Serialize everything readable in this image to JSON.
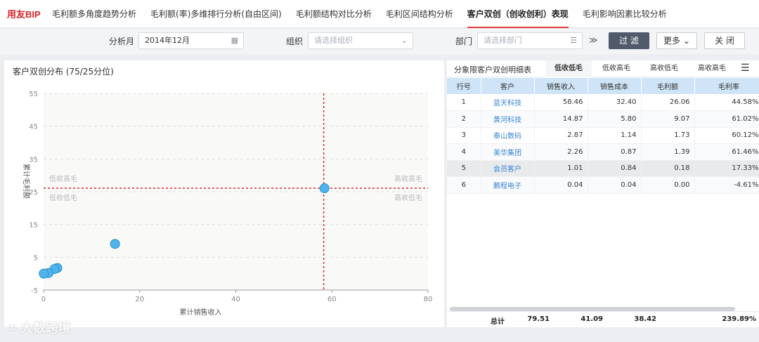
{
  "logo": "用友BIP",
  "tabs": [
    "毛利额多角度趋势分析",
    "毛利额(率)多维排行分析(自由区间)",
    "毛利额结构对比分析",
    "毛利区间结构分析",
    "客户双创（创收创利）表现",
    "毛利影响因素比较分析"
  ],
  "active_tab": 4,
  "filters": {
    "month_label": "分析月",
    "month_value": "2014年12月",
    "org_label": "组织",
    "org_placeholder": "请选择组织",
    "dept_label": "部门",
    "dept_placeholder": "请选择部门",
    "filter_btn": "过 滤",
    "more_btn": "更多",
    "close_btn": "关 闭"
  },
  "chart_data": {
    "type": "scatter",
    "title": "客户双创分布 (75/25分位)",
    "xlabel": "累计销售收入",
    "ylabel": "累计毛利额",
    "xlim": [
      0,
      80
    ],
    "ylim": [
      -5,
      55
    ],
    "xticks": [
      0,
      20,
      40,
      60,
      80
    ],
    "yticks": [
      -5,
      5,
      15,
      25,
      35,
      45,
      55
    ],
    "points": [
      [
        58.46,
        26.06
      ],
      [
        14.87,
        9.07
      ],
      [
        2.87,
        1.73
      ],
      [
        2.26,
        1.39
      ],
      [
        1.01,
        0.18
      ],
      [
        0.04,
        0
      ]
    ],
    "threshold_x": 58.3,
    "threshold_y": 26.06,
    "quadrant_labels": {
      "top_left": "低收高毛",
      "top_right": "高收高毛",
      "bottom_left": "低收低毛",
      "bottom_right": "高收低毛"
    },
    "colors": {
      "point": "#4fb4ea",
      "point_stroke": "#2a8fd0",
      "threshold": "#d9262c"
    }
  },
  "panel": {
    "title": "分象限客户双创明细表",
    "quadrant_tabs": [
      "低收低毛",
      "低收高毛",
      "高收低毛",
      "高收高毛"
    ],
    "active_quadrant": 0,
    "columns": [
      "行号",
      "客户",
      "销售收入",
      "销售成本",
      "毛利额",
      "毛利率"
    ],
    "rows": [
      [
        "1",
        "蓝天科技",
        "58.46",
        "32.40",
        "26.06",
        "44.58%"
      ],
      [
        "2",
        "黄河科技",
        "14.87",
        "5.80",
        "9.07",
        "61.02%"
      ],
      [
        "3",
        "泰山数码",
        "2.87",
        "1.14",
        "1.73",
        "60.12%"
      ],
      [
        "4",
        "美华集团",
        "2.26",
        "0.87",
        "1.39",
        "61.46%"
      ],
      [
        "5",
        "会员客户",
        "1.01",
        "0.84",
        "0.18",
        "17.33%"
      ],
      [
        "6",
        "鹏程电子",
        "0.04",
        "0.04",
        "0.00",
        "-4.61%"
      ]
    ],
    "total": {
      "label": "总计",
      "revenue": "79.51",
      "cost": "41.09",
      "profit": "38.42",
      "rate": "239.89%"
    }
  },
  "watermark": "大数跨境"
}
